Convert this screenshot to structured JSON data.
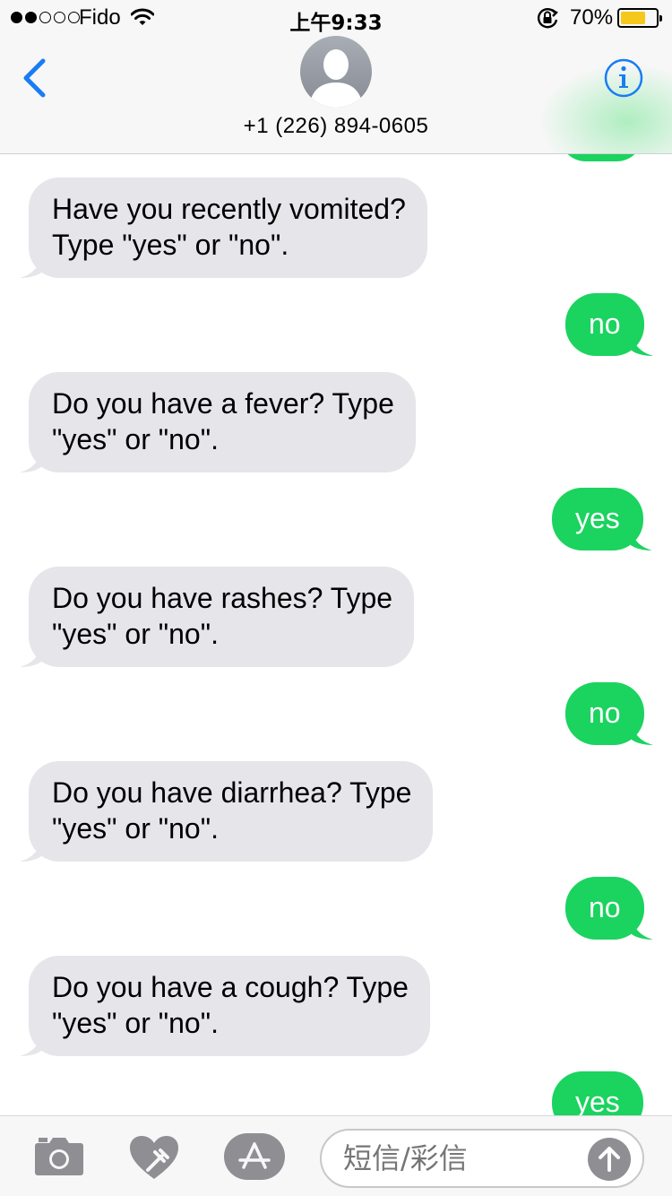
{
  "status_bar": {
    "carrier": "Fido",
    "time": "上午9:33",
    "battery_percent": "70%",
    "battery_level": 0.7,
    "signal_bars_filled": 2,
    "signal_bars_total": 5,
    "icons": [
      "signal-dots-icon",
      "wifi-icon",
      "rotation-lock-icon",
      "battery-icon"
    ]
  },
  "header": {
    "back_icon": "chevron-left-icon",
    "contact_number": "+1 (226) 894-0605",
    "info_icon": "info-icon",
    "accent_color": "#1a7cf5"
  },
  "messages": [
    {
      "direction": "incoming",
      "line1": "Have you recently vomited?",
      "line2": "Type \"yes\" or \"no\"."
    },
    {
      "direction": "outgoing",
      "text": "no"
    },
    {
      "direction": "incoming",
      "line1": "Do you have a fever? Type",
      "line2": "\"yes\" or \"no\"."
    },
    {
      "direction": "outgoing",
      "text": "yes"
    },
    {
      "direction": "incoming",
      "line1": "Do you have rashes? Type",
      "line2": "\"yes\" or \"no\"."
    },
    {
      "direction": "outgoing",
      "text": "no"
    },
    {
      "direction": "incoming",
      "line1": "Do you have diarrhea? Type",
      "line2": "\"yes\" or \"no\"."
    },
    {
      "direction": "outgoing",
      "text": "no"
    },
    {
      "direction": "incoming",
      "line1": "Do you have a cough? Type",
      "line2": "\"yes\" or \"no\"."
    },
    {
      "direction": "outgoing",
      "text": "yes"
    }
  ],
  "colors": {
    "incoming_bubble": "#e5e5ea",
    "outgoing_bubble": "#1bd35f"
  },
  "input_bar": {
    "placeholder": "短信/彩信",
    "icons": [
      "camera-icon",
      "digital-touch-icon",
      "app-store-icon",
      "send-arrow-icon"
    ]
  }
}
